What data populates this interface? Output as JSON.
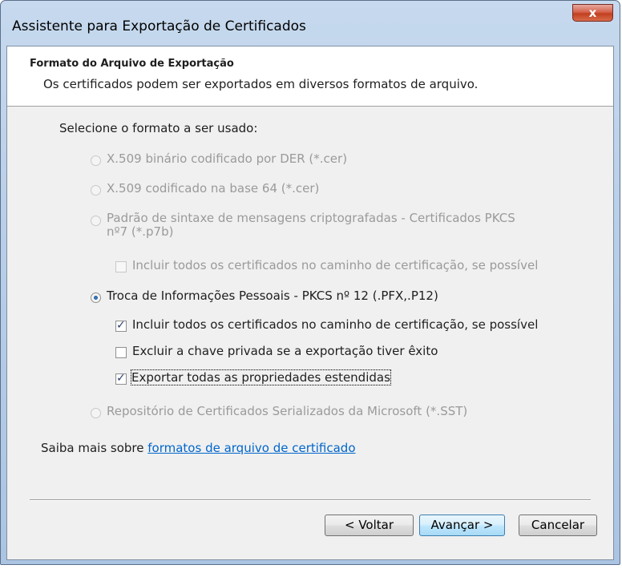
{
  "window": {
    "title": "Assistente para Exportação de Certificados",
    "close_glyph": "x"
  },
  "header": {
    "title": "Formato do Arquivo de Exportação",
    "subtitle": "Os certificados podem ser exportados em diversos formatos de arquivo."
  },
  "prompt": "Selecione o formato a ser usado:",
  "options": [
    {
      "label": "X.509 binário codificado por DER (*.cer)",
      "selected": false,
      "enabled": false
    },
    {
      "label": "X.509 codificado na base 64 (*.cer)",
      "selected": false,
      "enabled": false
    },
    {
      "label_line1": "Padrão de sintaxe de mensagens criptografadas - Certificados PKCS",
      "label_line2": "nº7 (*.p7b)",
      "selected": false,
      "enabled": false
    },
    {
      "label": "Troca de Informações Pessoais - PKCS nº 12 (.PFX,.P12)",
      "selected": true,
      "enabled": true
    },
    {
      "label": "Repositório de Certificados Serializados da Microsoft (*.SST)",
      "selected": false,
      "enabled": false
    }
  ],
  "checkboxes": {
    "p7b_include_all": {
      "label": "Incluir todos os certificados no caminho de certificação, se possível",
      "checked": false,
      "enabled": false
    },
    "pfx_include_all": {
      "label": "Incluir todos os certificados no caminho de certificação, se possível",
      "checked": true,
      "enabled": true
    },
    "pfx_delete_key": {
      "label": "Excluir a chave privada se a exportação tiver êxito",
      "checked": false,
      "enabled": true
    },
    "pfx_export_props": {
      "label": "Exportar todas as propriedades estendidas",
      "checked": true,
      "enabled": true
    }
  },
  "learn_more": {
    "prefix": "Saiba mais sobre ",
    "link": "formatos de arquivo de certificado"
  },
  "buttons": {
    "back": "< Voltar",
    "next": "Avançar >",
    "cancel": "Cancelar"
  },
  "check_glyph": "✓"
}
